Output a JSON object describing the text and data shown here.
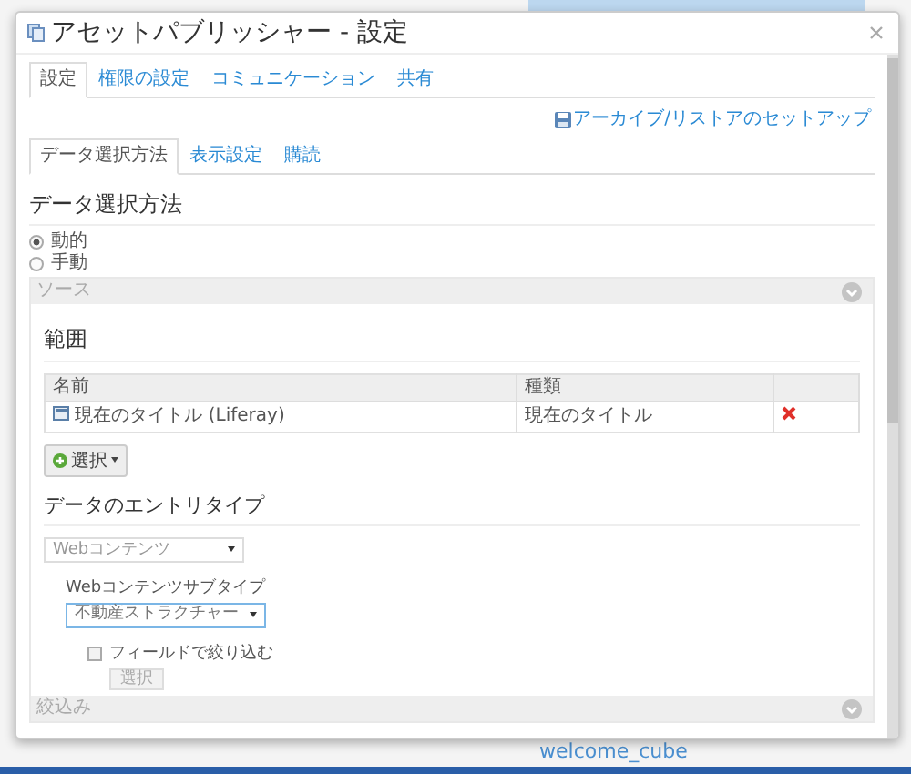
{
  "window": {
    "title": "アセットパブリッシャー - 設定"
  },
  "tabs": [
    {
      "label": "設定",
      "selected": true
    },
    {
      "label": "権限の設定",
      "selected": false
    },
    {
      "label": "コミュニケーション",
      "selected": false
    },
    {
      "label": "共有",
      "selected": false
    }
  ],
  "archive_link": "アーカイブ/リストアのセットアップ",
  "subtabs": [
    {
      "label": "データ選択方法",
      "selected": true
    },
    {
      "label": "表示設定",
      "selected": false
    },
    {
      "label": "購読",
      "selected": false
    }
  ],
  "section_title": "データ選択方法",
  "selection_methods": [
    {
      "label": "動的",
      "selected": true
    },
    {
      "label": "手動",
      "selected": false
    }
  ],
  "source_panel": {
    "title": "ソース",
    "scope_title": "範囲",
    "table": {
      "columns": [
        "名前",
        "種類"
      ],
      "rows": [
        {
          "name": "現在のタイトル (Liferay)",
          "type": "現在のタイトル"
        }
      ]
    },
    "select_button": "選択",
    "entry_type_title": "データのエントリタイプ",
    "entry_type": "Webコンテンツ",
    "subtype_label": "Webコンテンツサブタイプ",
    "subtype": "不動産ストラクチャー",
    "filter_checkbox": {
      "label": "フィールドで絞り込む",
      "checked": false
    },
    "filter_button": {
      "label": "選択",
      "disabled": true
    }
  },
  "filter_panel": {
    "title": "絞込み"
  },
  "background_text": "welcome_cube"
}
